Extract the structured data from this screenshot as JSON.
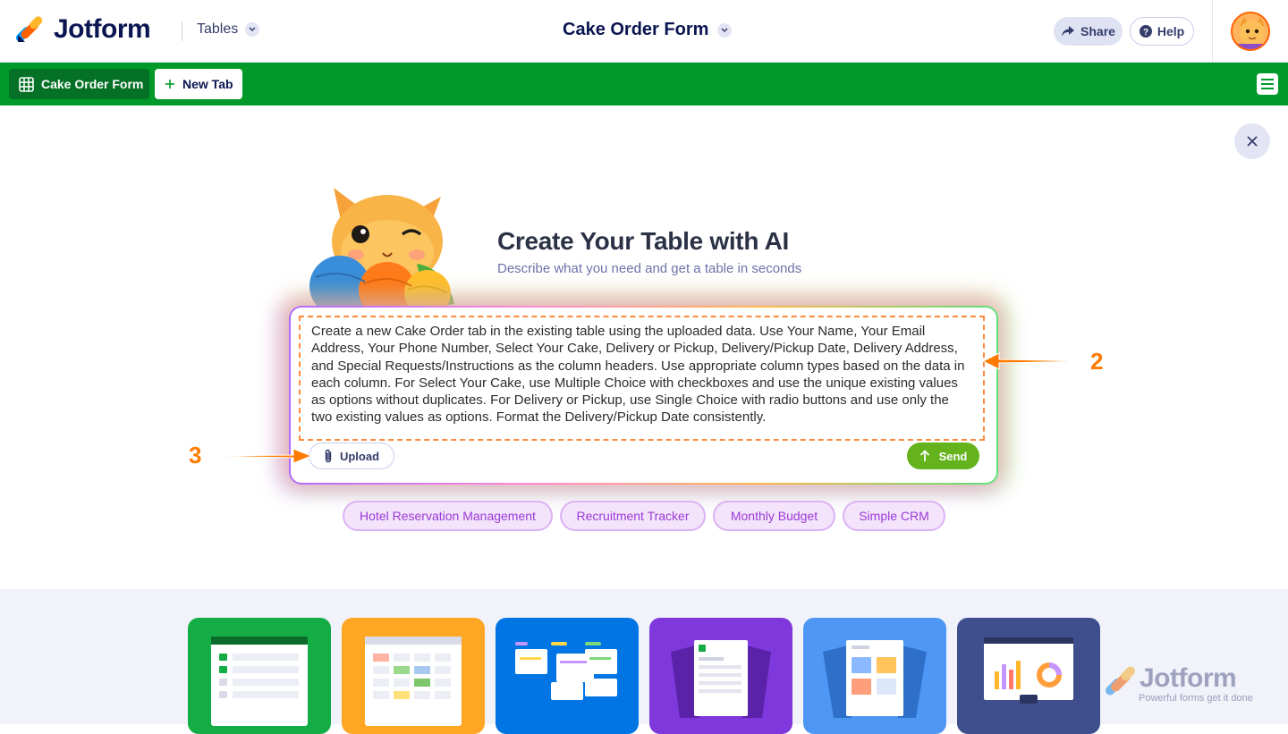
{
  "header": {
    "logo_text": "Jotform",
    "tables_label": "Tables",
    "form_title": "Cake Order Form",
    "share_label": "Share",
    "help_label": "Help"
  },
  "tabs": {
    "active_label": "Cake Order Form",
    "new_tab_label": "New Tab"
  },
  "ai": {
    "heading": "Create Your Table with AI",
    "subheading": "Describe what you need and get a table in seconds",
    "prompt": "Create a new Cake Order tab in the existing table using the uploaded data. Use Your Name, Your Email Address, Your Phone Number, Select Your Cake, Delivery or Pickup, Delivery/Pickup Date, Delivery Address, and Special Requests/Instructions as the column headers. Use appropriate column types based on the data in each column. For Select Your Cake, use Multiple Choice with checkboxes and use the unique existing values as options without duplicates. For Delivery or Pickup, use Single Choice with radio buttons and use only the two existing values as options. Format the Delivery/Pickup Date consistently.",
    "upload_label": "Upload",
    "send_label": "Send"
  },
  "suggestions": [
    "Hotel Reservation Management",
    "Recruitment Tracker",
    "Monthly Budget",
    "Simple CRM"
  ],
  "annotations": {
    "marker_2": "2",
    "marker_3": "3"
  },
  "watermark": {
    "brand": "Jotform",
    "tagline": "Powerful forms get it done"
  },
  "colors": {
    "tab_bar": "#01992a",
    "send": "#64b21c",
    "chip_text": "#9b3cd6",
    "annotation": "#ff7a00"
  }
}
